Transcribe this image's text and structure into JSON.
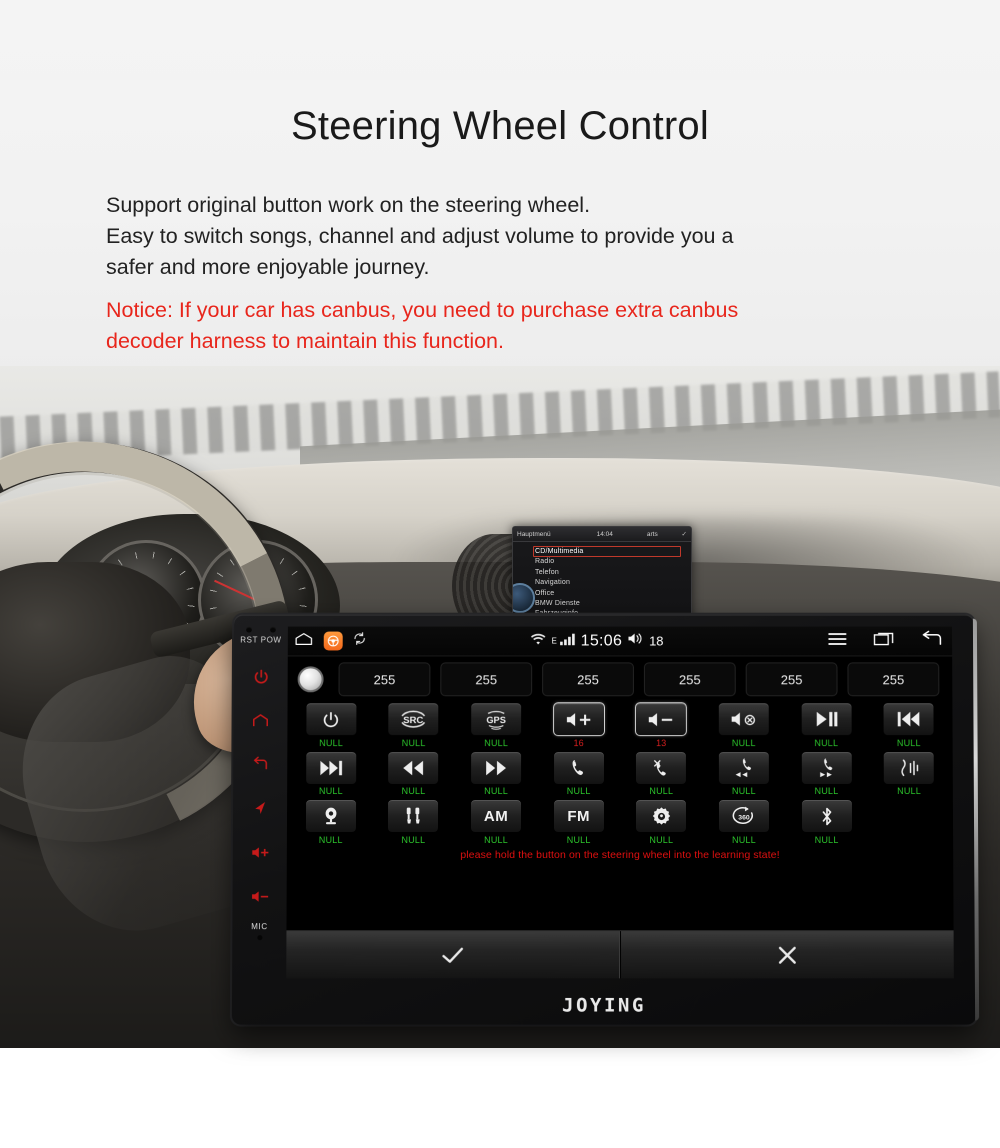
{
  "header": {
    "title": "Steering Wheel Control",
    "description_lines": [
      "Support original button work on the steering wheel.",
      "Easy to switch songs, channel and adjust volume to provide you a",
      "safer and more enjoyable journey."
    ],
    "notice_lines": [
      "Notice: If your car has canbus, you need to purchase extra canbus",
      "decoder harness to maintain this function."
    ],
    "notice_color": "#e8261c"
  },
  "car_screen": {
    "title": "Hauptmenü",
    "time": "14:04",
    "label_right": "arts",
    "menu": [
      "CD/Multimedia",
      "Radio",
      "Telefon",
      "Navigation",
      "Office",
      "BMW Dienste",
      "Fahrzeuginfo"
    ]
  },
  "device": {
    "brand": "JOYING",
    "left_bezel": {
      "rst_label": "RST",
      "pow_label": "POW",
      "mic_label": "MIC",
      "buttons": [
        "power",
        "home",
        "back",
        "navigation",
        "volume-up",
        "volume-down"
      ]
    },
    "statusbar": {
      "home_icon": "home-icon",
      "app_icon": "steering-wheel-app-icon",
      "sync_icon": "sync-icon",
      "wifi_icon": "wifi-icon",
      "network_type": "E",
      "signal_icon": "signal-bars-icon",
      "clock": "15:06",
      "volume_icon": "volume-icon",
      "volume_value": "18",
      "menu_icon": "menu-icon",
      "recents_icon": "recents-icon",
      "back_icon": "back-icon"
    },
    "value_row": {
      "indicator": "status-led",
      "values": [
        "255",
        "255",
        "255",
        "255",
        "255",
        "255"
      ]
    },
    "grid_rows": [
      [
        {
          "icon": "power-icon",
          "label": "NULL",
          "state": "null"
        },
        {
          "icon": "src-icon",
          "label": "NULL",
          "state": "null",
          "text": "SRC"
        },
        {
          "icon": "gps-icon",
          "label": "NULL",
          "state": "null",
          "text": "GPS"
        },
        {
          "icon": "volume-up-icon",
          "label": "16",
          "state": "assigned"
        },
        {
          "icon": "volume-down-icon",
          "label": "13",
          "state": "assigned"
        },
        {
          "icon": "volume-mute-icon",
          "label": "NULL",
          "state": "null"
        },
        {
          "icon": "play-pause-icon",
          "label": "NULL",
          "state": "null"
        },
        {
          "icon": "previous-track-icon",
          "label": "NULL",
          "state": "null"
        }
      ],
      [
        {
          "icon": "next-track-icon",
          "label": "NULL",
          "state": "null"
        },
        {
          "icon": "rewind-icon",
          "label": "NULL",
          "state": "null"
        },
        {
          "icon": "fast-forward-icon",
          "label": "NULL",
          "state": "null"
        },
        {
          "icon": "phone-answer-icon",
          "label": "NULL",
          "state": "null"
        },
        {
          "icon": "phone-hangup-icon",
          "label": "NULL",
          "state": "null"
        },
        {
          "icon": "phone-previous-icon",
          "label": "NULL",
          "state": "null"
        },
        {
          "icon": "phone-next-icon",
          "label": "NULL",
          "state": "null"
        },
        {
          "icon": "voice-command-icon",
          "label": "NULL",
          "state": "null"
        }
      ],
      [
        {
          "icon": "camera-icon",
          "label": "NULL",
          "state": "null"
        },
        {
          "icon": "aux-icon",
          "label": "NULL",
          "state": "null"
        },
        {
          "icon": "am-icon",
          "label": "NULL",
          "state": "null",
          "text": "AM"
        },
        {
          "icon": "fm-icon",
          "label": "NULL",
          "state": "null",
          "text": "FM"
        },
        {
          "icon": "settings-icon",
          "label": "NULL",
          "state": "null"
        },
        {
          "icon": "rotate-360-icon",
          "label": "NULL",
          "state": "null",
          "text": "360"
        },
        {
          "icon": "bluetooth-icon",
          "label": "NULL",
          "state": "null"
        }
      ]
    ],
    "learn_message": "please hold the button on the steering wheel into the learning state!",
    "actions": [
      {
        "icon": "check-icon",
        "name": "confirm"
      },
      {
        "icon": "close-icon",
        "name": "cancel"
      }
    ],
    "colors": {
      "label_null": "#2cc62c",
      "label_assigned": "#d81f1f",
      "warning": "#e01010",
      "bezel_icon": "#c61a1a",
      "app_accent": "#f4681b"
    }
  }
}
